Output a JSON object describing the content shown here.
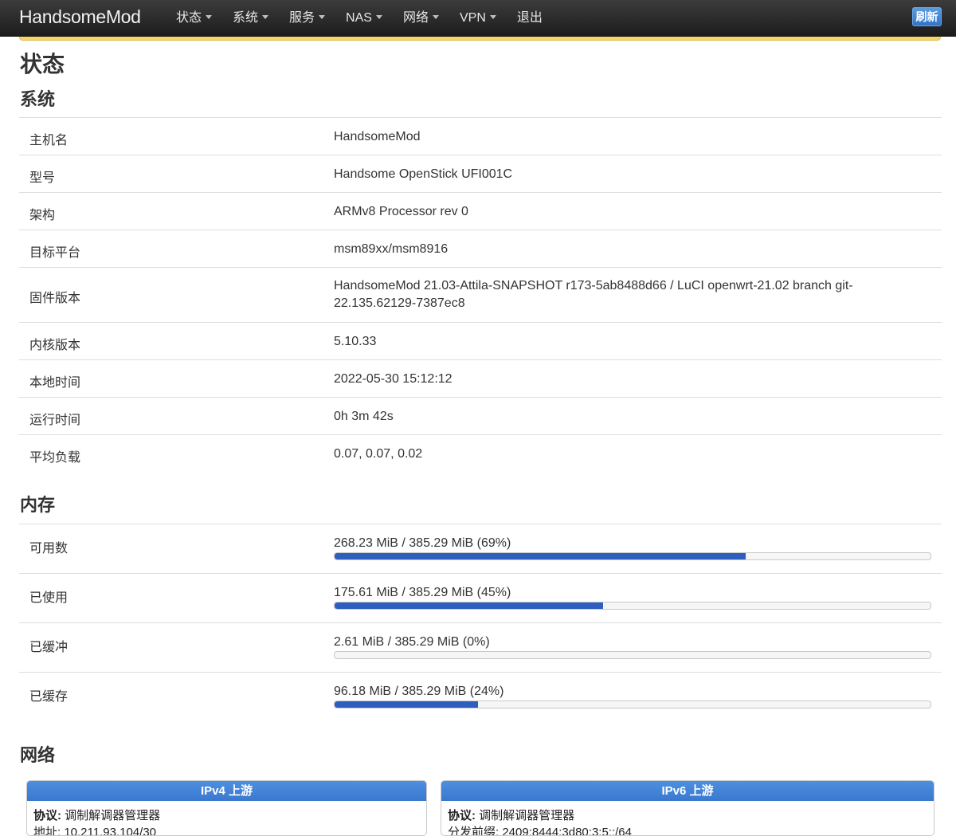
{
  "navbar": {
    "brand": "HandsomeMod",
    "menu": [
      {
        "label": "状态",
        "dropdown": true
      },
      {
        "label": "系统",
        "dropdown": true
      },
      {
        "label": "服务",
        "dropdown": true
      },
      {
        "label": "NAS",
        "dropdown": true
      },
      {
        "label": "网络",
        "dropdown": true
      },
      {
        "label": "VPN",
        "dropdown": true
      },
      {
        "label": "退出",
        "dropdown": false
      }
    ],
    "refresh_label": "刷新",
    "refresh_color": "#3a7fd6",
    "alert_color": "#f5d66b"
  },
  "page": {
    "title": "状态"
  },
  "system": {
    "title": "系统",
    "rows": [
      {
        "label": "主机名",
        "value": "HandsomeMod"
      },
      {
        "label": "型号",
        "value": "Handsome OpenStick UFI001C"
      },
      {
        "label": "架构",
        "value": "ARMv8 Processor rev 0"
      },
      {
        "label": "目标平台",
        "value": "msm89xx/msm8916"
      },
      {
        "label": "固件版本",
        "value": "HandsomeMod 21.03-Attila-SNAPSHOT r173-5ab8488d66 / LuCI openwrt-21.02 branch git-22.135.62129-7387ec8"
      },
      {
        "label": "内核版本",
        "value": "5.10.33"
      },
      {
        "label": "本地时间",
        "value": "2022-05-30 15:12:12"
      },
      {
        "label": "运行时间",
        "value": "0h 3m 42s"
      },
      {
        "label": "平均负载",
        "value": "0.07, 0.07, 0.02"
      }
    ]
  },
  "memory": {
    "title": "内存",
    "bar_color": "#2e5fbf",
    "rows": [
      {
        "label": "可用数",
        "text": "268.23 MiB / 385.29 MiB (69%)",
        "percent": 69
      },
      {
        "label": "已使用",
        "text": "175.61 MiB / 385.29 MiB (45%)",
        "percent": 45
      },
      {
        "label": "已缓冲",
        "text": "2.61 MiB / 385.29 MiB (0%)",
        "percent": 0
      },
      {
        "label": "已缓存",
        "text": "96.18 MiB / 385.29 MiB (24%)",
        "percent": 24
      }
    ]
  },
  "network": {
    "title": "网络",
    "cards": [
      {
        "header": "IPv4 上游",
        "proto_label": "协议:",
        "proto_value": "调制解调器管理器",
        "line2": "地址: 10.211.93.104/30"
      },
      {
        "header": "IPv6 上游",
        "proto_label": "协议:",
        "proto_value": "调制解调器管理器",
        "line2": "分发前缀: 2409:8444:3d80:3:5::/64"
      }
    ]
  }
}
